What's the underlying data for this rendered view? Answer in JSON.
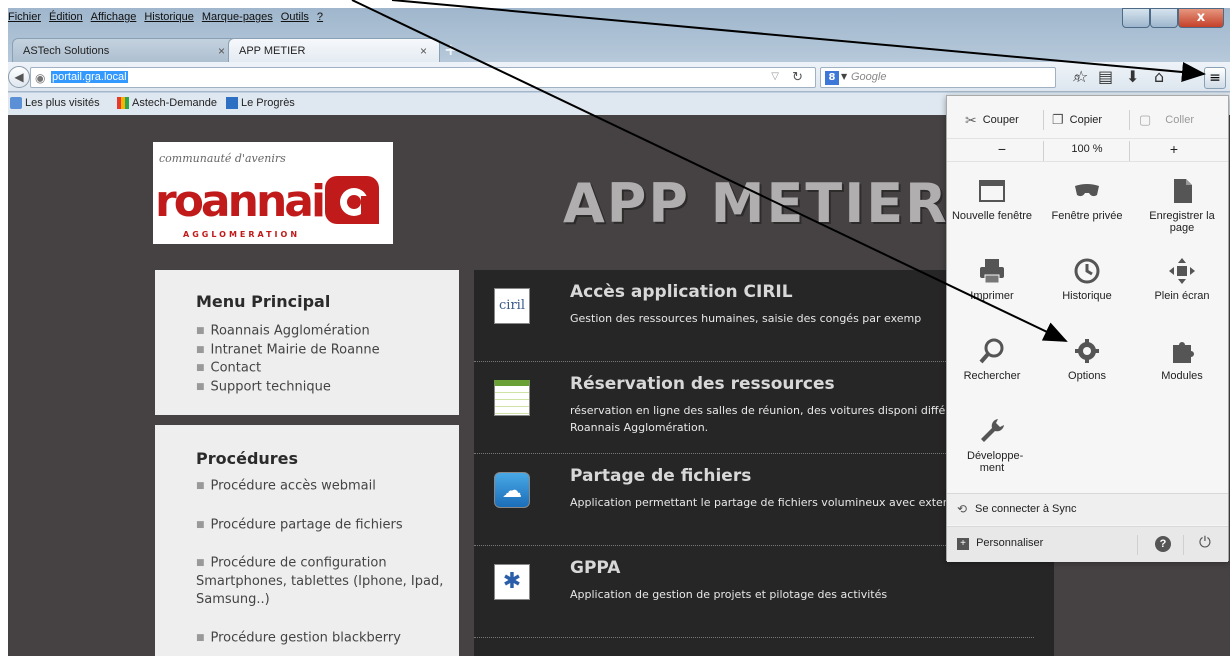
{
  "menubar": [
    "Fichier",
    "Édition",
    "Affichage",
    "Historique",
    "Marque-pages",
    "Outils",
    "?"
  ],
  "window_controls": {
    "close": "x"
  },
  "tabs": [
    {
      "label": "ASTech Solutions",
      "close": "×"
    },
    {
      "label": "APP METIER",
      "close": "×"
    }
  ],
  "new_tab": "+",
  "navbar": {
    "url": "portail.gra.local",
    "search_placeholder": "Google",
    "search_engine_letter": "8"
  },
  "bookmarks": [
    "Les plus visités",
    "Astech-Demande",
    "Le Progrès"
  ],
  "page": {
    "logo_tagline": "communauté d'avenirs",
    "logo_word": "roannais",
    "logo_sub": "AGGLOMERATION",
    "title": "APP METIER",
    "menu_principal": {
      "heading": "Menu Principal",
      "items": [
        "Roannais Agglomération",
        "Intranet Mairie de Roanne",
        "Contact",
        "Support technique"
      ]
    },
    "procedures": {
      "heading": "Procédures",
      "items": [
        "Procédure accès webmail",
        "Procédure partage de fichiers",
        "Procédure de configuration Smartphones, tablettes (Iphone, Ipad, Samsung..)",
        "Procédure gestion blackberry"
      ]
    },
    "apps": [
      {
        "title": "Accès application CIRIL",
        "desc": "Gestion des ressources humaines, saisie des congés par exemp",
        "icon": "ciril-logo-icon"
      },
      {
        "title": "Réservation des ressources",
        "desc": "réservation en ligne des salles de réunion, des voitures disponi différents sites de Roannais Agglomération.",
        "icon": "calendar-icon"
      },
      {
        "title": "Partage de fichiers",
        "desc": "Application permettant le partage de fichiers volumineux avec externes.",
        "icon": "cloud-upload-icon"
      },
      {
        "title": "GPPA",
        "desc": "Application de gestion de projets et pilotage des activités",
        "icon": "puzzle-icon"
      }
    ]
  },
  "panel": {
    "edit": [
      "Couper",
      "Copier",
      "Coller"
    ],
    "zoom": {
      "minus": "−",
      "value": "100 %",
      "plus": "+"
    },
    "grid": [
      {
        "label": "Nouvelle fenêtre",
        "icon": "new-window-icon"
      },
      {
        "label": "Fenêtre privée",
        "icon": "private-mask-icon"
      },
      {
        "label": "Enregistrer la page",
        "icon": "save-page-icon"
      },
      {
        "label": "Imprimer",
        "icon": "print-icon"
      },
      {
        "label": "Historique",
        "icon": "history-clock-icon"
      },
      {
        "label": "Plein écran",
        "icon": "fullscreen-icon"
      },
      {
        "label": "Rechercher",
        "icon": "search-icon"
      },
      {
        "label": "Options",
        "icon": "gear-icon"
      },
      {
        "label": "Modules",
        "icon": "puzzle-icon"
      },
      {
        "label": "Développe- ment",
        "icon": "wrench-icon"
      }
    ],
    "sync": "Se connecter à Sync",
    "customize": "Personnaliser"
  },
  "colors": {
    "page_bg": "#464243",
    "panel_bg": "#f6f6f6",
    "brand_red": "#c11a1a",
    "app_panel_bg": "#272626"
  }
}
